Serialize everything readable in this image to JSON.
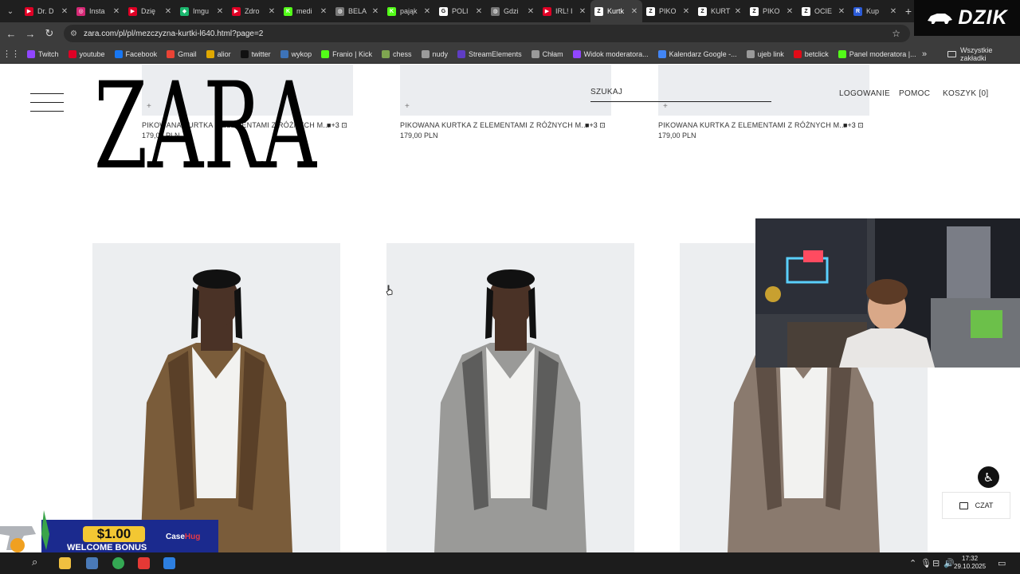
{
  "browser": {
    "tabs": [
      {
        "label": "Dr. D",
        "color": "#e00025",
        "glyph": "▶"
      },
      {
        "label": "Insta",
        "color": "#d62976",
        "glyph": "◎"
      },
      {
        "label": "Dzię",
        "color": "#e00025",
        "glyph": "▶"
      },
      {
        "label": "Imgu",
        "color": "#1bb76e",
        "glyph": "◆"
      },
      {
        "label": "Zdro",
        "color": "#e00025",
        "glyph": "▶"
      },
      {
        "label": "medi",
        "color": "#53fc18",
        "glyph": "K"
      },
      {
        "label": "BELA",
        "color": "#777777",
        "glyph": "◍"
      },
      {
        "label": "pająk",
        "color": "#53fc18",
        "glyph": "K"
      },
      {
        "label": "POLI",
        "color": "#ffffff",
        "glyph": "G"
      },
      {
        "label": "Gdzi",
        "color": "#777777",
        "glyph": "◍"
      },
      {
        "label": "IRL! I",
        "color": "#e00025",
        "glyph": "▶"
      },
      {
        "label": "Kurtk",
        "color": "#ffffff",
        "glyph": "Z",
        "active": true
      },
      {
        "label": "PIKO",
        "color": "#ffffff",
        "glyph": "Z"
      },
      {
        "label": "KURT",
        "color": "#ffffff",
        "glyph": "Z"
      },
      {
        "label": "PIKO",
        "color": "#ffffff",
        "glyph": "Z"
      },
      {
        "label": "OCIE",
        "color": "#ffffff",
        "glyph": "Z"
      },
      {
        "label": "Kup",
        "color": "#2b5bd7",
        "glyph": "R"
      }
    ],
    "dzik_label": "DZIK",
    "url": "zara.com/pl/pl/mezczyzna-kurtki-l640.html?page=2",
    "bookmarks": [
      {
        "label": "Twitch",
        "color": "#9146ff"
      },
      {
        "label": "youtube",
        "color": "#e00025"
      },
      {
        "label": "Facebook",
        "color": "#1877f2"
      },
      {
        "label": "Gmail",
        "color": "#ea4335"
      },
      {
        "label": "alior",
        "color": "#e0a800"
      },
      {
        "label": "twitter",
        "color": "#111111"
      },
      {
        "label": "wykop",
        "color": "#3d73b8"
      },
      {
        "label": "Franio | Kick",
        "color": "#53fc18"
      },
      {
        "label": "chess",
        "color": "#7fa650"
      },
      {
        "label": "nudy",
        "color": "#9a9a9a"
      },
      {
        "label": "StreamElements",
        "color": "#5f3dc4"
      },
      {
        "label": "Chłam",
        "color": "#9a9a9a"
      },
      {
        "label": "Widok moderatora...",
        "color": "#9146ff"
      },
      {
        "label": "Kalendarz Google -...",
        "color": "#4285f4"
      },
      {
        "label": "ujeb link",
        "color": "#9a9a9a"
      },
      {
        "label": "betclick",
        "color": "#e10b17"
      },
      {
        "label": "Panel moderatora |...",
        "color": "#53fc18"
      }
    ],
    "all_bookmarks_label": "Wszystkie zakładki"
  },
  "site": {
    "logo_text": "ZARA",
    "search_label": "SZUKAJ",
    "nav": {
      "login": "LOGOWANIE",
      "help": "POMOC",
      "cart": "KOSZYK [0]"
    }
  },
  "previous_products": [
    {
      "name": "PIKOWANA KURTKA Z ELEMENTAMI Z RÓŻNYCH M...",
      "price": "179,00 PLN",
      "colors": "+3"
    },
    {
      "name": "PIKOWANA KURTKA Z ELEMENTAMI Z RÓŻNYCH M...",
      "price": "179,00 PLN",
      "colors": "+3"
    },
    {
      "name": "PIKOWANA KURTKA Z ELEMENTAMI Z RÓŻNYCH M...",
      "price": "179,00 PLN",
      "colors": "+3"
    }
  ],
  "products": [
    {
      "image": "brown faux fur jacket",
      "fur_color": "#7a5c3a",
      "fur_dark": "#5a4028"
    },
    {
      "image": "grey faux fur hooded jacket",
      "fur_color": "#9a9a98",
      "fur_dark": "#5d5d5c"
    },
    {
      "image": "taupe faux fur jacket",
      "fur_color": "#8a7a6e",
      "fur_dark": "#5e4f45"
    }
  ],
  "widgets": {
    "chat_label": "CZAT"
  },
  "promo": {
    "amount": "$1.00",
    "text": "WELCOME BONUS",
    "brand_a": "Case",
    "brand_b": "Hug"
  },
  "taskbar": {
    "time": "17:32",
    "date": "29.10.2025"
  }
}
